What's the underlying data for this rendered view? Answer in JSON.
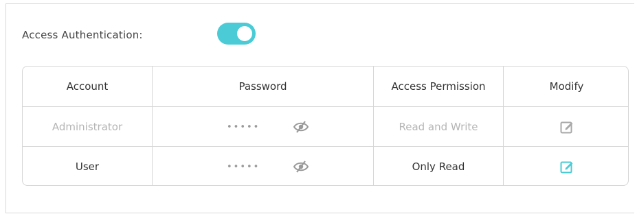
{
  "auth": {
    "label": "Access Authentication:",
    "enabled": true,
    "accent": "#4acbd6"
  },
  "table": {
    "headers": [
      "Account",
      "Password",
      "Access Permission",
      "Modify"
    ],
    "rows": [
      {
        "account": "Administrator",
        "password_mask": "•••••",
        "permission": "Read and Write",
        "edit_icon": "edit-icon",
        "enabled": false
      },
      {
        "account": "User",
        "password_mask": "•••••",
        "permission": "Only Read",
        "edit_icon": "edit-icon",
        "enabled": true
      }
    ]
  },
  "colors": {
    "border": "#d6d6d6",
    "disabled_text": "#b5b5b5",
    "icon_gray": "#9a9a9a",
    "icon_active": "#4acbd6"
  }
}
